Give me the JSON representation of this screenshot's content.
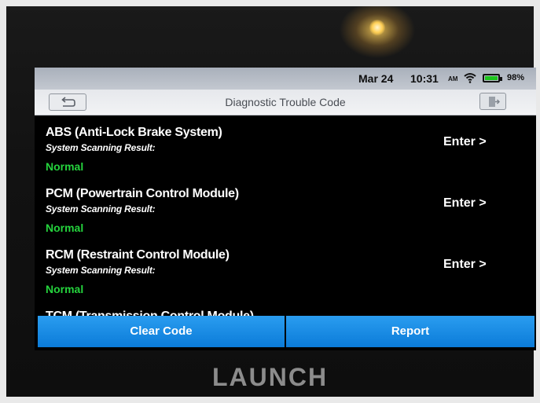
{
  "status_bar": {
    "date": "Mar 24",
    "time": "10:31",
    "ampm": "AM",
    "battery": "98%",
    "battery_level": 0.98
  },
  "header": {
    "title": "Diagnostic Trouble Code",
    "back_icon": "back-arrow-icon",
    "exit_icon": "exit-icon"
  },
  "systems": [
    {
      "name": "ABS (Anti-Lock Brake System)",
      "result_label": "System Scanning Result:",
      "result": "Normal",
      "action": "Enter >"
    },
    {
      "name": "PCM (Powertrain Control Module)",
      "result_label": "System Scanning Result:",
      "result": "Normal",
      "action": "Enter >"
    },
    {
      "name": "RCM (Restraint Control Module)",
      "result_label": "System Scanning Result:",
      "result": "Normal",
      "action": "Enter >"
    },
    {
      "name": "TCM (Transmission Control Module)"
    }
  ],
  "buttons": {
    "clear": "Clear Code",
    "report": "Report"
  },
  "device_brand": "LAUNCH",
  "colors": {
    "normal_status": "#25d33d",
    "button_blue": "#1a8ce6",
    "screen_bg": "#000000"
  }
}
